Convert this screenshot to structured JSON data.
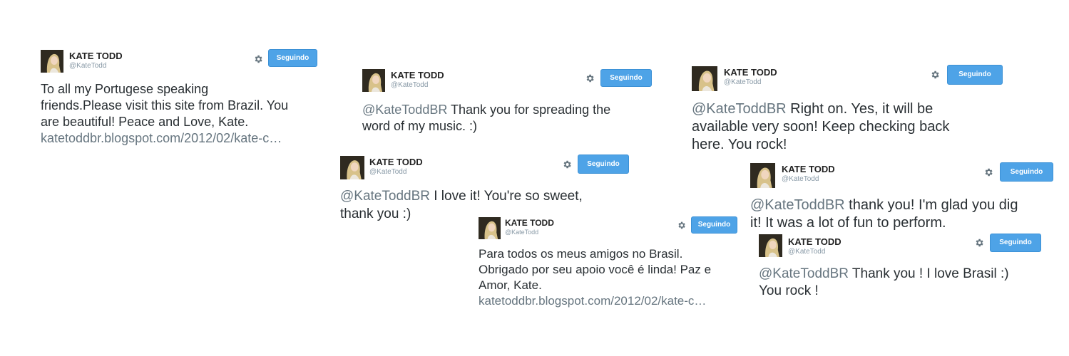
{
  "profile": {
    "name": "KATE TODD",
    "handle": "@KateTodd",
    "follow_label": "Seguindo"
  },
  "tweets": [
    {
      "line1": "To all my Portugese speaking",
      "line2": "friends.Please visit this site from Brazil. You",
      "line3": "are beautiful!  Peace and Love, Kate.",
      "link": "katetoddbr.blogspot.com/2012/02/kate-c…"
    },
    {
      "mention": "@KateToddBR",
      "line1": " Thank you for spreading the",
      "line2": "word of my music. :)"
    },
    {
      "mention": "@KateToddBR",
      "line1": " Right on. Yes, it will be",
      "line2": "available very soon! Keep checking back",
      "line3": "here. You rock!"
    },
    {
      "mention": "@KateToddBR",
      "line1": " I love it! You're so sweet,",
      "line2": "thank you :)"
    },
    {
      "mention": "@KateToddBR",
      "line1": " thank you! I'm glad you dig",
      "line2": "it! It was a lot of fun to perform."
    },
    {
      "line1": "Para todos os meus amigos no Brasil.",
      "line2": "Obrigado por seu apoio você é linda! Paz e",
      "line3": "Amor, Kate.",
      "link": "katetoddbr.blogspot.com/2012/02/kate-c…"
    },
    {
      "mention": "@KateToddBR",
      "line1": " Thank you ! I love Brasil :)",
      "line2": "You rock !"
    }
  ]
}
